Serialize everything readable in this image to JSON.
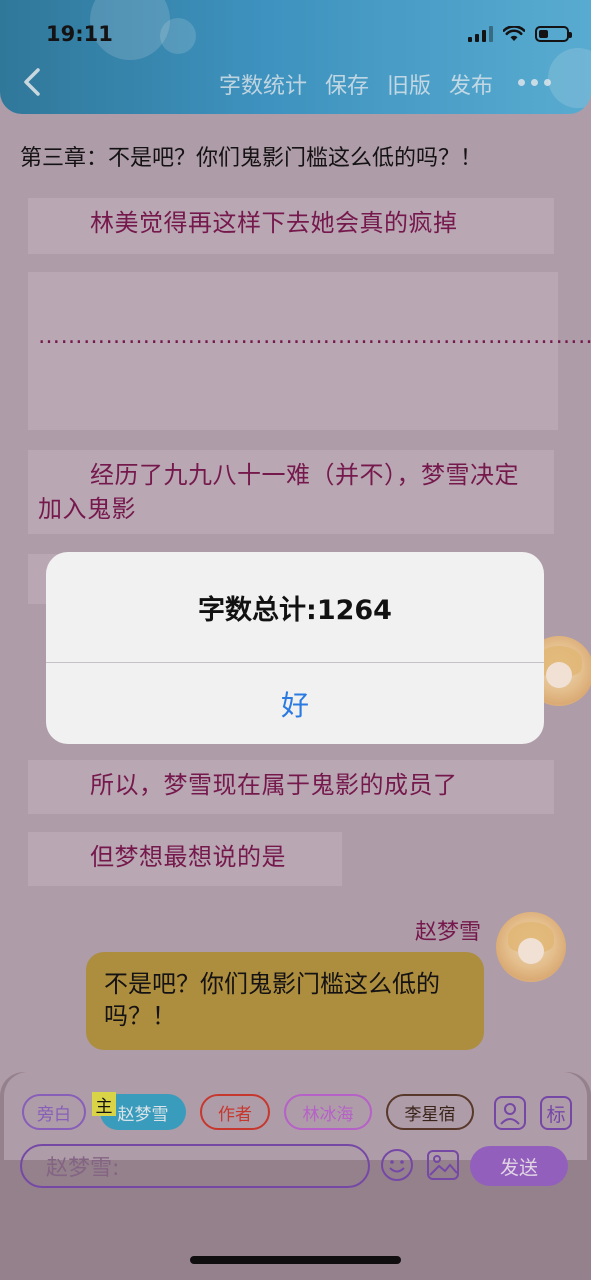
{
  "status_bar": {
    "time": "19:11"
  },
  "toolbar": {
    "word_count": "字数统计",
    "save": "保存",
    "old_version": "旧版",
    "publish": "发布"
  },
  "chapter_title": "第三章：不是吧？你们鬼影门槛这么低的吗？！",
  "paragraphs": {
    "p1": "林美觉得再这样下去她会真的疯掉",
    "p2": "……………………………………………………………………………………………………",
    "p3": "经历了九九八十一难（并不），梦雪决定加入鬼影",
    "p5": "所以，梦雪现在属于鬼影的成员了",
    "p6": "但梦想最想说的是"
  },
  "message": {
    "speaker": "赵梦雪",
    "text": "不是吧？你们鬼影门槛这么低的吗？！"
  },
  "roles": {
    "narrator": "旁白",
    "main_tag": "主",
    "zhao": "赵梦雪",
    "author": "作者",
    "lin": "林冰海",
    "li": "李星宿",
    "tag_icon": "标"
  },
  "input": {
    "prefix": "赵梦雪:",
    "send": "发送"
  },
  "dialog": {
    "message": "字数总计:1264",
    "ok": "好"
  },
  "colors": {
    "header": "#3e9ccb",
    "paragraph_text": "#7a1850",
    "bubble": "#b7963f",
    "send_button": "#9a64c8",
    "dialog_button": "#2a7ae2"
  }
}
